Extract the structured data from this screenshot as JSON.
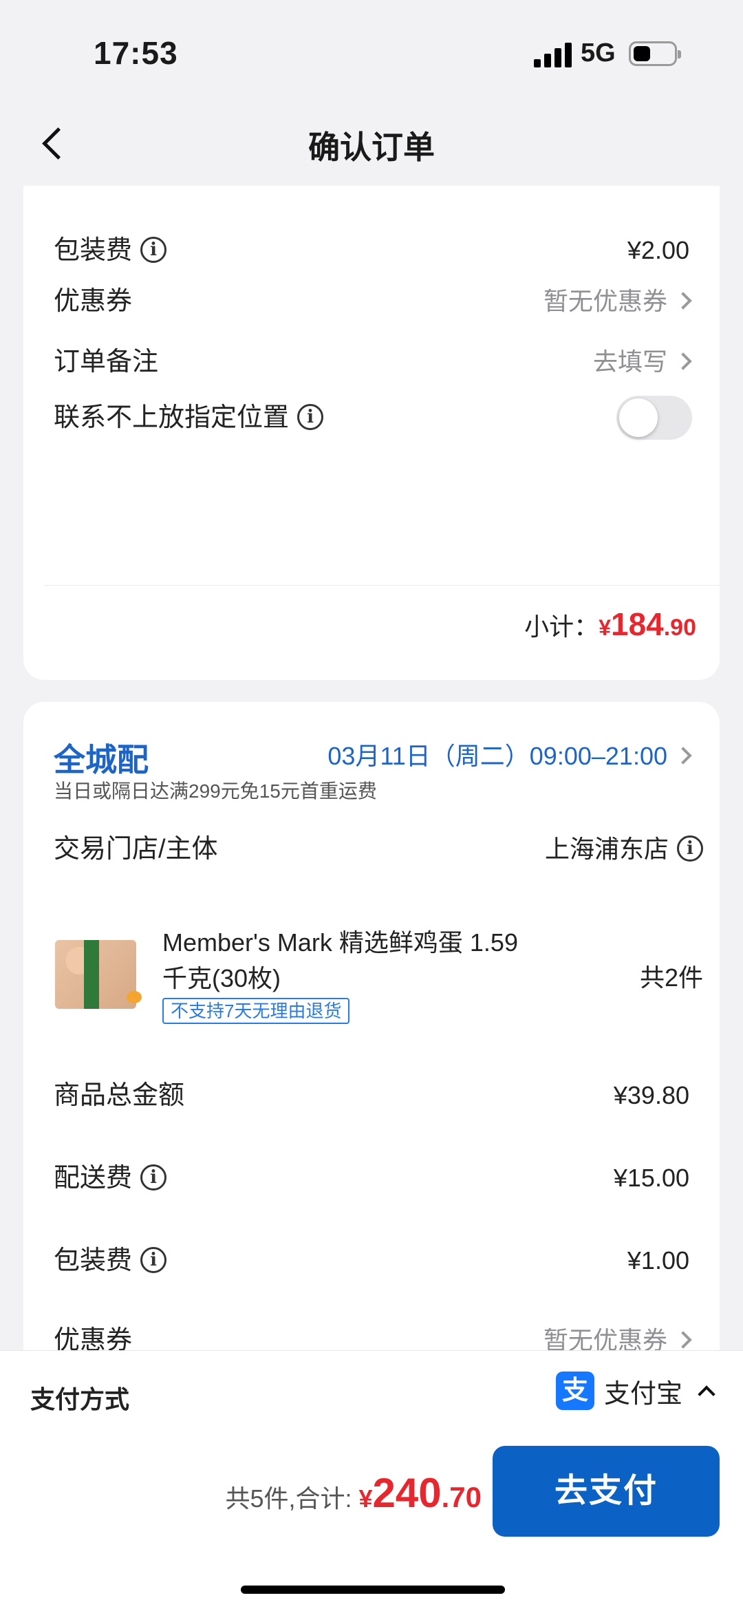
{
  "status": {
    "time": "17:53",
    "network": "5G"
  },
  "nav": {
    "title": "确认订单"
  },
  "section1": {
    "packaging_fee": {
      "label": "包装费",
      "value": "¥2.00"
    },
    "coupon": {
      "label": "优惠券",
      "value": "暂无优惠券"
    },
    "note": {
      "label": "订单备注",
      "value": "去填写"
    },
    "contact_fallback": {
      "label": "联系不上放指定位置",
      "enabled": false
    },
    "subtotal": {
      "label": "小计：",
      "currency": "¥",
      "integer": "184",
      "decimal": ".90"
    }
  },
  "section2": {
    "delivery": {
      "name": "全城配",
      "time": "03月11日（周二）09:00–21:00",
      "note": "当日或隔日达满299元免15元首重运费"
    },
    "store": {
      "label": "交易门店/主体",
      "value": "上海浦东店"
    },
    "product": {
      "title": "Member's Mark 精选鲜鸡蛋 1.59千克(30枚)",
      "tag": "不支持7天无理由退货",
      "count": "共2件"
    },
    "goods_total": {
      "label": "商品总金额",
      "value": "¥39.80"
    },
    "delivery_fee": {
      "label": "配送费",
      "value": "¥15.00"
    },
    "packaging_fee": {
      "label": "包装费",
      "value": "¥1.00"
    },
    "coupon": {
      "label": "优惠券",
      "value": "暂无优惠券"
    }
  },
  "bottom": {
    "payment_label": "支付方式",
    "payment_method": "支付宝",
    "alipay_glyph": "支",
    "total_prefix": "共5件,合计:",
    "total_currency": "¥",
    "total_integer": "240",
    "total_decimal": ".70",
    "pay_button": "去支付"
  },
  "colors": {
    "accent_blue": "#0b62c4",
    "price_red": "#e8262e",
    "link_blue": "#1c64c8"
  }
}
